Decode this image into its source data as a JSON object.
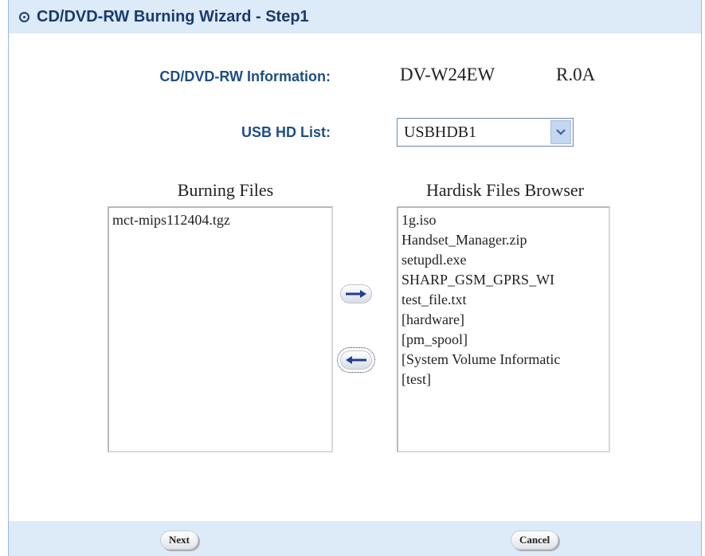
{
  "window": {
    "title": "CD/DVD-RW Burning Wizard - Step1"
  },
  "info": {
    "label": "CD/DVD-RW Information:",
    "model": "DV-W24EW",
    "revision": "R.0A"
  },
  "usb": {
    "label": "USB HD List:",
    "selected": "USBHDB1"
  },
  "burning": {
    "heading": "Burning Files",
    "files": [
      "mct-mips112404.tgz"
    ]
  },
  "browser": {
    "heading": "Hardisk Files Browser",
    "files": [
      "1g.iso",
      "Handset_Manager.zip",
      "setupdl.exe",
      "SHARP_GSM_GPRS_WI",
      "test_file.txt",
      "[hardware]",
      "[pm_spool]",
      "[System Volume Informatic",
      "[test]"
    ]
  },
  "footer": {
    "next_label": "Next",
    "cancel_label": "Cancel"
  },
  "colors": {
    "title_bar": "#ddeaf7",
    "label_blue": "#1e4e84",
    "arrow_blue": "#1f3f8f"
  }
}
